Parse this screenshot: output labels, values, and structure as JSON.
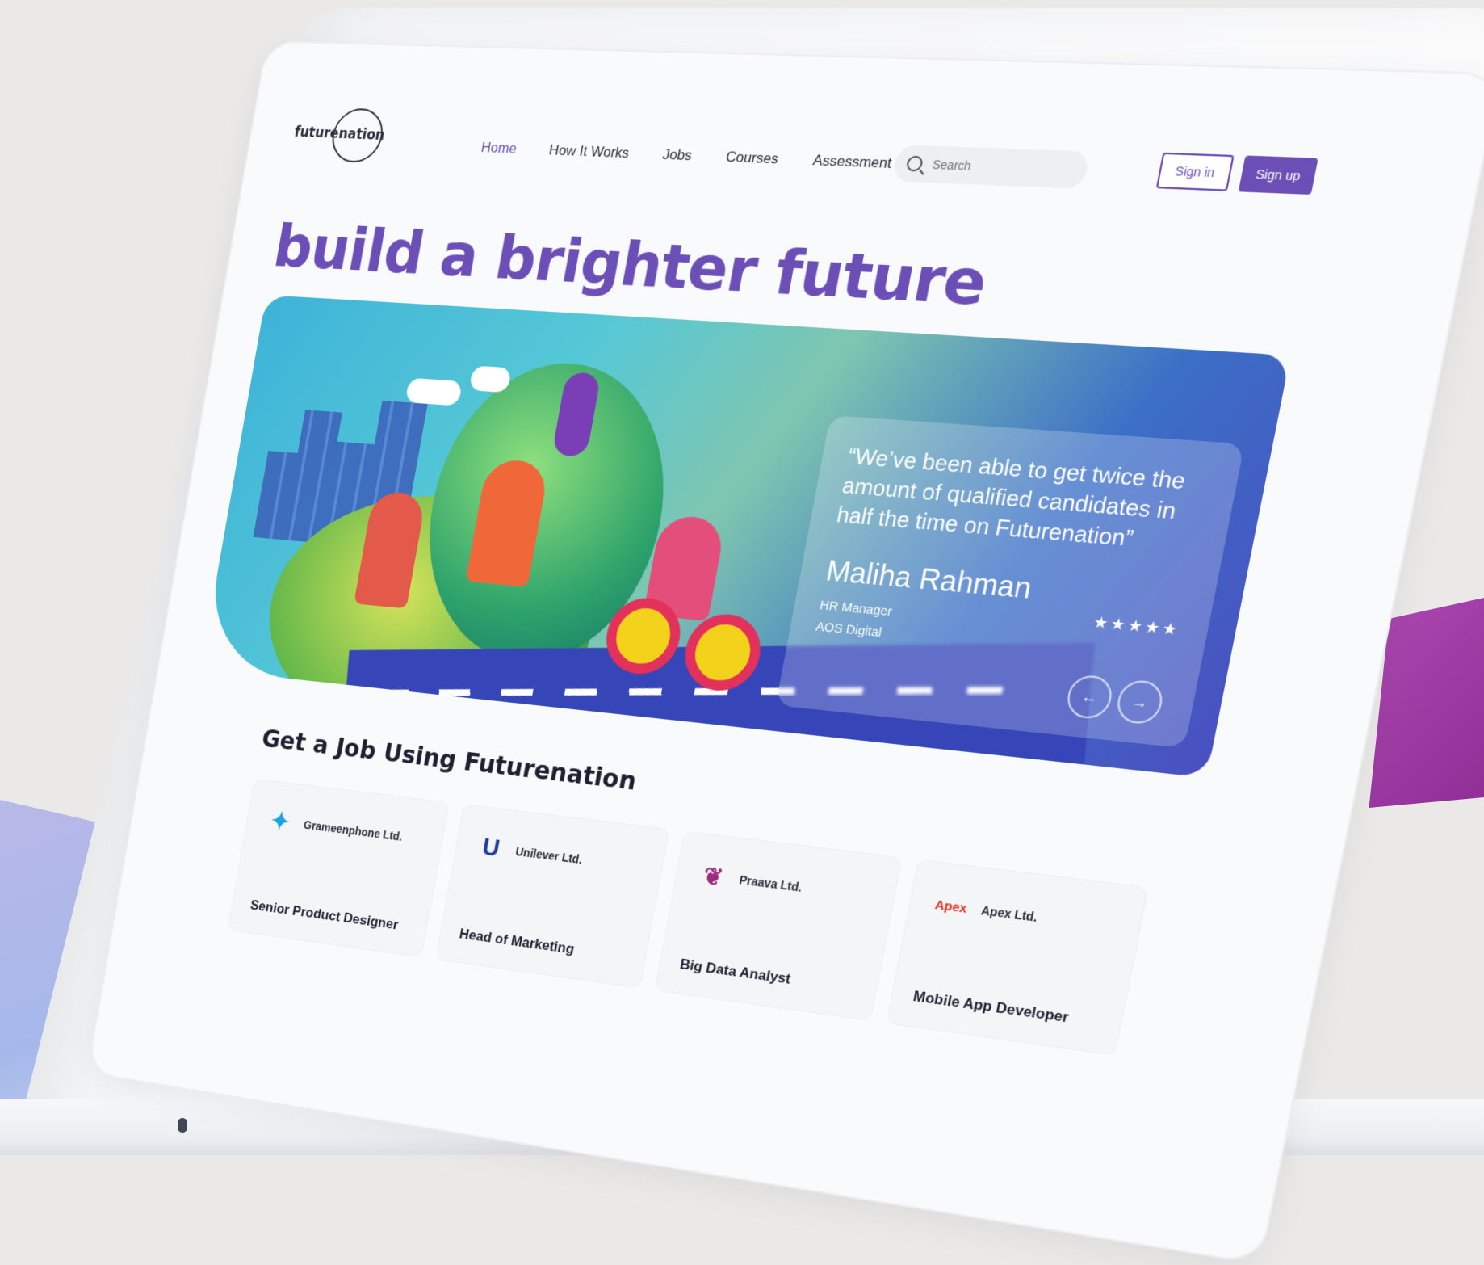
{
  "header": {
    "logo_text": "futurenation",
    "nav": [
      {
        "label": "Home",
        "active": true
      },
      {
        "label": "How It Works",
        "active": false
      },
      {
        "label": "Jobs",
        "active": false
      },
      {
        "label": "Courses",
        "active": false
      },
      {
        "label": "Assessment",
        "active": false
      }
    ],
    "search_placeholder": "Search",
    "signin_label": "Sign in",
    "signup_label": "Sign up"
  },
  "hero": {
    "title": "build a brighter future"
  },
  "testimonial": {
    "quote": "“We’ve been able to get twice the amount of qualified candidates in half the time on Futurenation”",
    "name": "Maliha Rahman",
    "role": "HR Manager",
    "company": "AOS Digital",
    "stars": "★★★★★",
    "prev_arrow": "←",
    "next_arrow": "→"
  },
  "jobs_section": {
    "title": "Get a Job Using Futurenation",
    "jobs": [
      {
        "company": "Grameenphone Ltd.",
        "title": "Senior Product Designer",
        "logo_color": "#1aa3e0",
        "logo_glyph": "✦"
      },
      {
        "company": "Unilever Ltd.",
        "title": "Head of Marketing",
        "logo_color": "#1f3fa0",
        "logo_glyph": "U"
      },
      {
        "company": "Praava Ltd.",
        "title": "Big Data Analyst",
        "logo_color": "#9b2a7c",
        "logo_glyph": "❦"
      },
      {
        "company": "Apex Ltd.",
        "title": "Mobile App Developer",
        "logo_color": "#e0301e",
        "logo_glyph": "Apex"
      }
    ]
  },
  "colors": {
    "brand_purple": "#6b4fb6",
    "accent_magenta": "#a23ba9"
  }
}
